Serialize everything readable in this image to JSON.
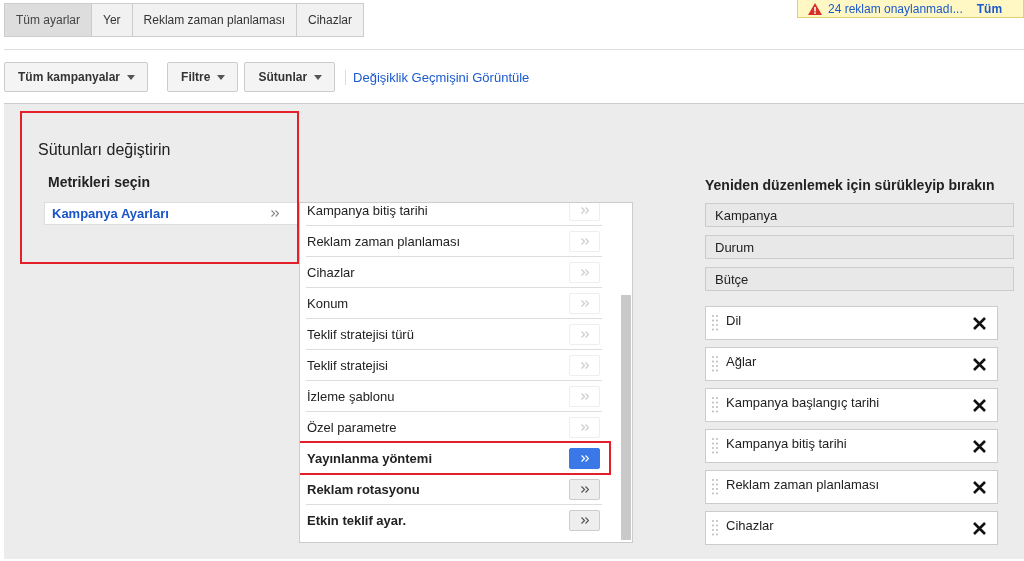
{
  "tabs": [
    {
      "label": "Tüm ayarlar",
      "selected": true
    },
    {
      "label": "Yer",
      "selected": false
    },
    {
      "label": "Reklam zaman planlaması",
      "selected": false
    },
    {
      "label": "Cihazlar",
      "selected": false
    }
  ],
  "notification": {
    "text": "24 reklam onaylanmadı...",
    "link": "Tüm"
  },
  "toolbar": {
    "buttons": [
      {
        "label": "Tüm kampanyalar"
      },
      {
        "label": "Filtre"
      },
      {
        "label": "Sütunlar"
      }
    ],
    "link": "Değişiklik Geçmişini Görüntüle"
  },
  "dialog": {
    "title": "Sütunları değiştirin",
    "metrics_heading": "Metrikleri seçin",
    "highlighted": true,
    "categories": [
      {
        "label": "Kampanya Ayarları",
        "selected": true
      }
    ],
    "metrics": [
      {
        "label": "Kampanya bitiş tarihi",
        "added": true,
        "selected": false,
        "highlighted": false
      },
      {
        "label": "Reklam zaman planlaması",
        "added": true,
        "selected": false,
        "highlighted": false
      },
      {
        "label": "Cihazlar",
        "added": true,
        "selected": false,
        "highlighted": false
      },
      {
        "label": "Konum",
        "added": true,
        "selected": false,
        "highlighted": false
      },
      {
        "label": "Teklif stratejisi türü",
        "added": true,
        "selected": false,
        "highlighted": false
      },
      {
        "label": "Teklif stratejisi",
        "added": true,
        "selected": false,
        "highlighted": false
      },
      {
        "label": "İzleme şablonu",
        "added": true,
        "selected": false,
        "highlighted": false
      },
      {
        "label": "Özel parametre",
        "added": true,
        "selected": false,
        "highlighted": false
      },
      {
        "label": "Yayınlanma yöntemi",
        "added": false,
        "selected": true,
        "highlighted": true
      },
      {
        "label": "Reklam rotasyonu",
        "added": false,
        "selected": false,
        "highlighted": false
      },
      {
        "label": "Etkin teklif ayar.",
        "added": false,
        "selected": false,
        "highlighted": false
      }
    ],
    "arrange_heading": "Yeniden düzenlemek için sürükleyip bırakın",
    "fixed_columns": [
      "Kampanya",
      "Durum",
      "Bütçe"
    ],
    "columns": [
      "Dil",
      "Ağlar",
      "Kampanya başlangıç tarihi",
      "Kampanya bitiş tarihi",
      "Reklam zaman planlaması",
      "Cihazlar"
    ]
  }
}
